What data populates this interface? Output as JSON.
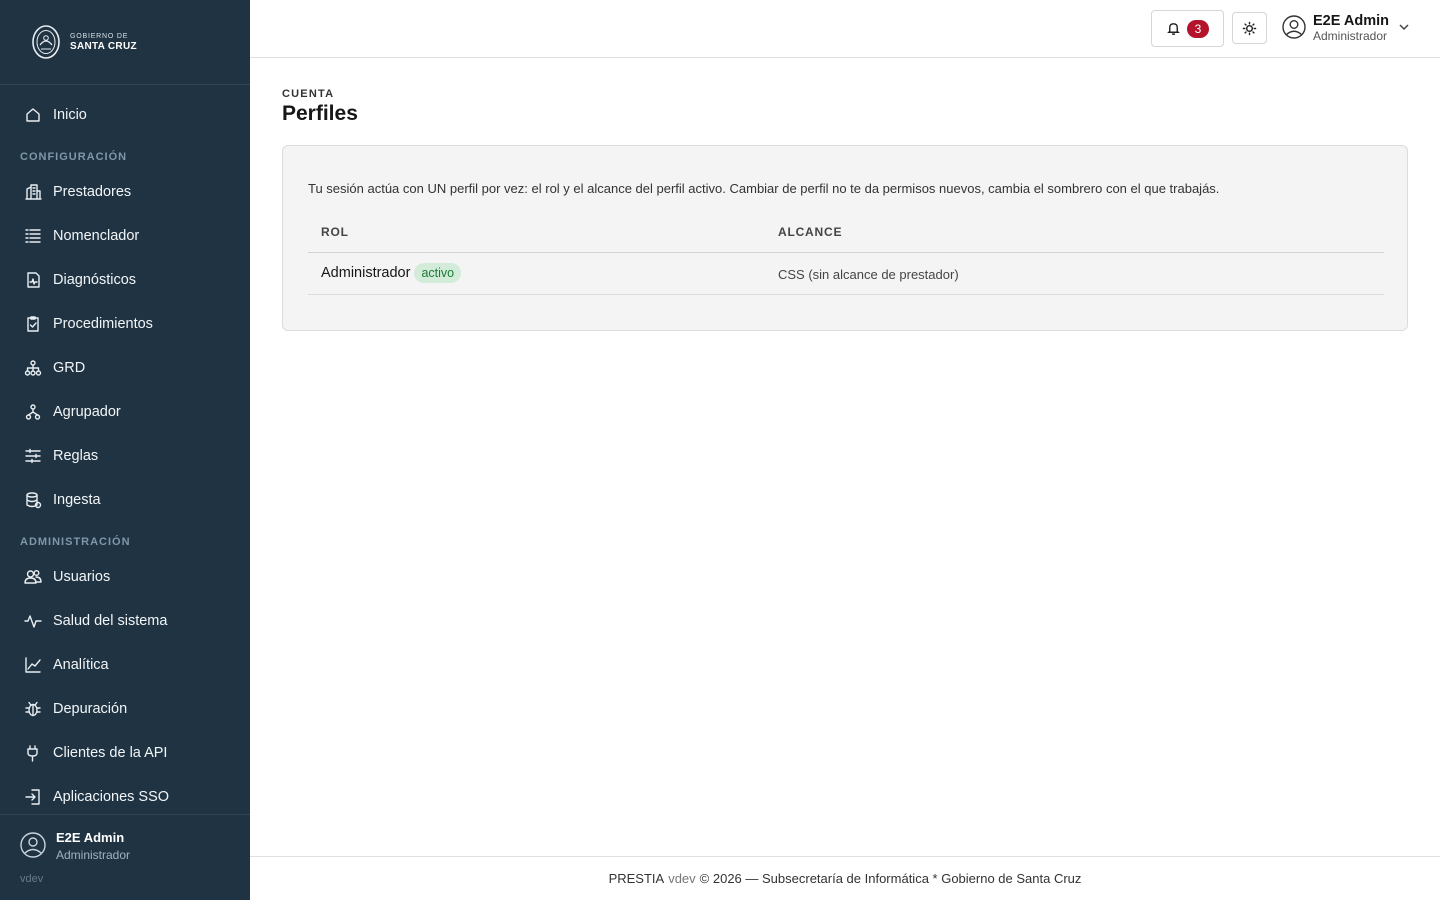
{
  "brand": {
    "line1": "GOBIERNO DE",
    "line2": "SANTA CRUZ"
  },
  "sidebar": {
    "home": {
      "label": "Inicio",
      "icon": "home-icon"
    },
    "section_config": "CONFIGURACIÓN",
    "config_items": [
      {
        "label": "Prestadores",
        "icon": "building-icon"
      },
      {
        "label": "Nomenclador",
        "icon": "list-icon"
      },
      {
        "label": "Diagnósticos",
        "icon": "medical-record-icon"
      },
      {
        "label": "Procedimientos",
        "icon": "clipboard-check-icon"
      },
      {
        "label": "GRD",
        "icon": "hierarchy-icon"
      },
      {
        "label": "Agrupador",
        "icon": "tree-icon"
      },
      {
        "label": "Reglas",
        "icon": "sliders-icon"
      },
      {
        "label": "Ingesta",
        "icon": "database-icon"
      }
    ],
    "section_admin": "ADMINISTRACIÓN",
    "admin_items": [
      {
        "label": "Usuarios",
        "icon": "users-icon"
      },
      {
        "label": "Salud del sistema",
        "icon": "activity-icon"
      },
      {
        "label": "Analítica",
        "icon": "chart-line-icon"
      },
      {
        "label": "Depuración",
        "icon": "bug-icon"
      },
      {
        "label": "Clientes de la API",
        "icon": "plug-icon"
      },
      {
        "label": "Aplicaciones SSO",
        "icon": "login-icon"
      }
    ],
    "footer": {
      "user_name": "E2E Admin",
      "user_role": "Administrador",
      "version": "vdev"
    }
  },
  "header": {
    "notification_count": "3",
    "user_name": "E2E Admin",
    "user_role": "Administrador"
  },
  "page": {
    "eyebrow": "CUENTA",
    "title": "Perfiles",
    "intro": "Tu sesión actúa con UN perfil por vez: el rol y el alcance del perfil activo. Cambiar de perfil no te da permisos nuevos, cambia el sombrero con el que trabajás.",
    "table": {
      "columns": [
        "ROL",
        "ALCANCE"
      ],
      "rows": [
        {
          "rol": "Administrador",
          "badge": "activo",
          "alcance": "CSS (sin alcance de prestador)"
        }
      ]
    }
  },
  "footer": {
    "app": "PRESTIA",
    "version": "vdev",
    "rest": "© 2026 — Subsecretaría de Informática * Gobierno de Santa Cruz"
  },
  "colors": {
    "sidebar_bg": "#1f3342",
    "badge_red": "#b3132b",
    "active_green": "#1d7a35"
  }
}
